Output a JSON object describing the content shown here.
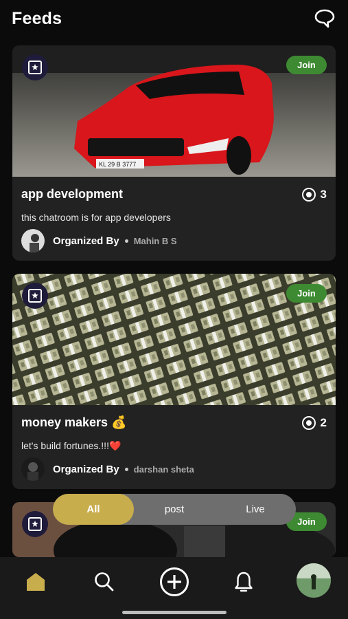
{
  "header": {
    "title": "Feeds",
    "chat_icon": "chat-bubble-icon"
  },
  "posts": [
    {
      "title": "app development",
      "emoji": "",
      "views": "3",
      "description": "this chatroom is for app developers",
      "organized_label": "Organized By",
      "organizer": "Mahin B S",
      "join_label": "Join",
      "image": "red sports car photo",
      "plate_text": "KL 29 B 3777"
    },
    {
      "title": "money makers",
      "emoji": "💰",
      "views": "2",
      "description": "let's build fortunes.!!!❤️",
      "organized_label": "Organized By",
      "organizer": "darshan sheta",
      "join_label": "Join",
      "image": "stacks of cash photo"
    },
    {
      "join_label": "Join",
      "image": "motorcycle photo"
    }
  ],
  "filter": {
    "tabs": [
      "All",
      "post",
      "Live"
    ],
    "active": "All"
  },
  "nav": {
    "items": [
      "home-icon",
      "search-icon",
      "add-icon",
      "bell-icon",
      "profile-avatar"
    ]
  },
  "colors": {
    "accent": "#c8ad4d",
    "join": "#3e8a33",
    "background": "#0b0b0b",
    "card": "#222222"
  }
}
